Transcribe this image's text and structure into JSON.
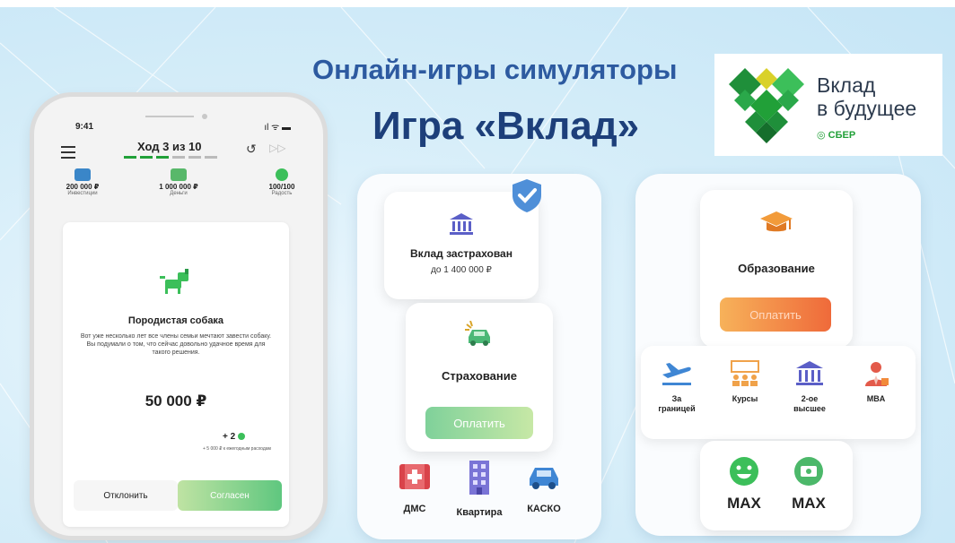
{
  "headline": {
    "line1": "Онлайн-игры симуляторы",
    "line2": "Игра «Вклад»"
  },
  "logo": {
    "title_line1": "Вклад",
    "title_line2": "в будущее",
    "brand": "СБЕР"
  },
  "phone": {
    "time": "9:41",
    "status_icons": "ıl ᯤ ▬",
    "turn": "Ход 3 из 10",
    "stats": [
      {
        "value": "200 000 ₽",
        "label": "Инвестиции",
        "icon": "briefcase-icon"
      },
      {
        "value": "1 000 000 ₽",
        "label": "Деньги",
        "icon": "money-icon"
      },
      {
        "value": "100/100",
        "label": "Радость",
        "icon": "smile-icon"
      }
    ],
    "card": {
      "title": "Породистая собака",
      "description": "Вот уже несколько лет все члены семьи мечтают завести собаку. Вы подумали о том, что сейчас довольно удачное время для такого решения.",
      "price": "50 000 ₽",
      "bonus": "+ 2",
      "bonus_note": "+ 5 000 ₽ к ежегодным расходам"
    },
    "decline_label": "Отклонить",
    "accept_label": "Согласен"
  },
  "middle": {
    "deposit_title": "Вклад застрахован",
    "deposit_sub": "до 1 400 000 ₽",
    "insurance_title": "Страхование",
    "pay_label": "Оплатить",
    "items": [
      {
        "label": "ДМС",
        "icon": "medical-kit-icon"
      },
      {
        "label": "Квартира",
        "icon": "building-icon"
      },
      {
        "label": "КАСКО",
        "icon": "car-icon"
      }
    ]
  },
  "right": {
    "education_title": "Образование",
    "pay_label": "Оплатить",
    "items": [
      {
        "label_line1": "За",
        "label_line2": "границей",
        "icon": "airplane-icon"
      },
      {
        "label_line1": "Курсы",
        "label_line2": "",
        "icon": "classroom-icon"
      },
      {
        "label_line1": "2-ое",
        "label_line2": "высшее",
        "icon": "university-icon"
      },
      {
        "label_line1": "MBA",
        "label_line2": "",
        "icon": "manager-icon"
      }
    ],
    "max": [
      {
        "label": "MAX",
        "icon": "smile-icon"
      },
      {
        "label": "MAX",
        "icon": "money-icon"
      }
    ]
  },
  "colors": {
    "headline_blue": "#2d5aa0",
    "sber_green": "#21a038",
    "pay_green": "#7fd19a",
    "pay_orange": "#ef6a3a"
  }
}
